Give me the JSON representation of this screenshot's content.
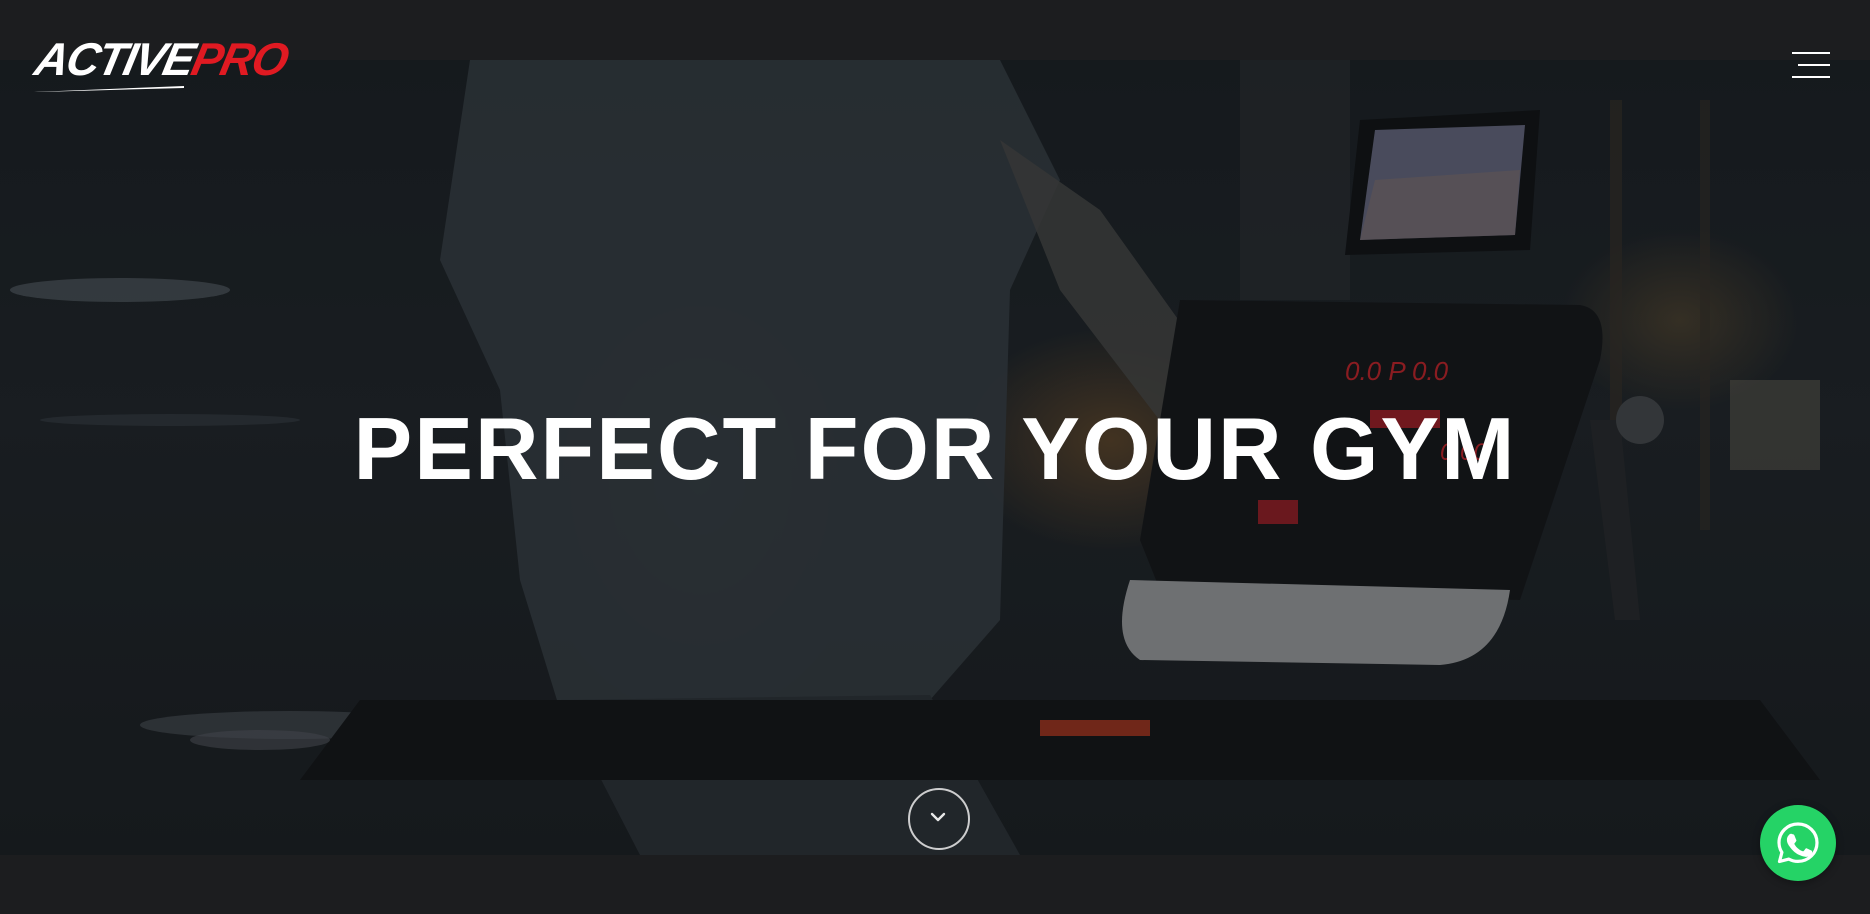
{
  "brand": {
    "logo_part1": "ACTIVE",
    "logo_part2": "PRO",
    "logo_primary_color": "#ffffff",
    "logo_accent_color": "#e01a22"
  },
  "header": {
    "menu_icon": "hamburger-menu-icon"
  },
  "hero": {
    "headline": "PERFECT FOR YOUR GYM",
    "scroll_icon": "chevron-down-icon"
  },
  "whatsapp": {
    "icon": "whatsapp-icon",
    "color": "#25d366"
  }
}
